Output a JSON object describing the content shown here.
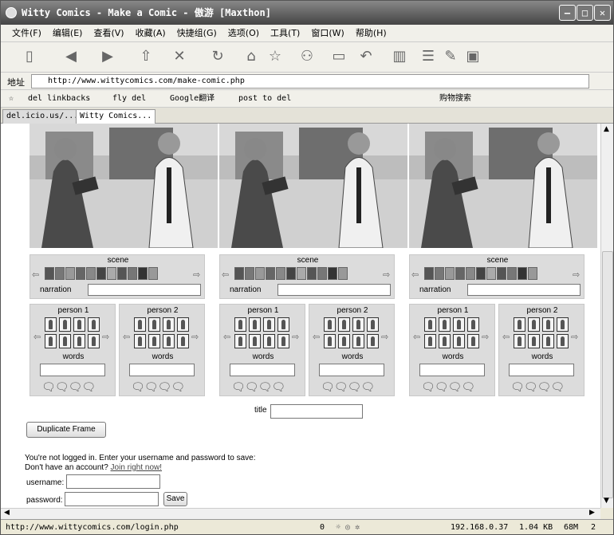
{
  "window": {
    "title": "Witty Comics - Make a Comic - 傲游 [Maxthon]"
  },
  "menu": [
    "文件(F)",
    "编辑(E)",
    "查看(V)",
    "收藏(A)",
    "快捷组(G)",
    "选项(O)",
    "工具(T)",
    "窗口(W)",
    "帮助(H)"
  ],
  "address": {
    "label": "地址",
    "url": "http://www.wittycomics.com/make-comic.php"
  },
  "bookmarks": [
    "del linkbacks",
    "fly del",
    "Google翻译",
    "post to del"
  ],
  "search_label": "购物搜索",
  "tabs": [
    "del.icio.us/...",
    "Witty Comics..."
  ],
  "comic": {
    "scene_label": "scene",
    "narration_label": "narration",
    "person1_label": "person 1",
    "person2_label": "person 2",
    "words_label": "words",
    "title_label": "title",
    "duplicate_button": "Duplicate Frame",
    "scene_colors": [
      "#555",
      "#777",
      "#999",
      "#666",
      "#888",
      "#444",
      "#aaa",
      "#555",
      "#777",
      "#333",
      "#999"
    ]
  },
  "login": {
    "line1": "You're not logged in. Enter your username and password to save:",
    "line2_prefix": "Don't have an account?",
    "join_link": "Join right now!",
    "username_label": "username:",
    "password_label": "password:",
    "save_button": "Save"
  },
  "status": {
    "url": "http://www.wittycomics.com/login.php",
    "count": "0",
    "ip": "192.168.0.37",
    "size": "1.04 KB",
    "mem": "68M",
    "num": "2"
  }
}
